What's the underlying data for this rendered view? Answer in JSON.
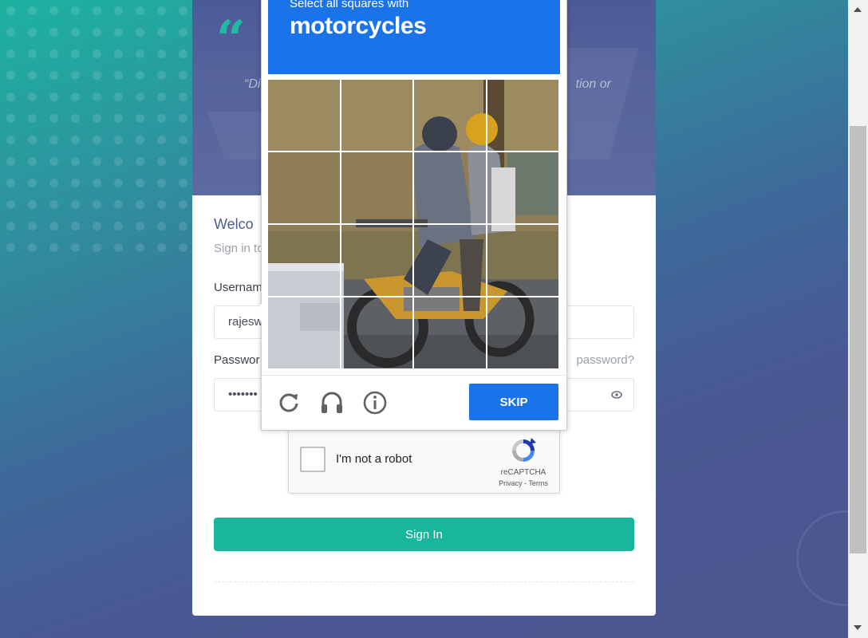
{
  "hero": {
    "quote_mark": "“",
    "quote_left": "“Di",
    "quote_right": "tion or"
  },
  "login": {
    "welcome": "Welco",
    "subtitle": "Sign in to",
    "username_label": "Usernam",
    "username_value": "rajesw",
    "password_label": "Passwor",
    "password_value": "•••••••",
    "forgot_label": "password?",
    "signin_label": "Sign In"
  },
  "recaptcha": {
    "checkbox_label": "I'm not a robot",
    "brand": "reCAPTCHA",
    "links": "Privacy - Terms"
  },
  "challenge": {
    "instruction": "Select all squares with",
    "target": "motorcycles",
    "grid_rows": 4,
    "grid_cols": 4,
    "skip_label": "SKIP",
    "icons": [
      "reload-icon",
      "audio-headphones-icon",
      "info-icon"
    ]
  },
  "colors": {
    "brand_teal": "#18b79c",
    "captcha_blue": "#1a73e8",
    "title_navy": "#4b5a93"
  }
}
